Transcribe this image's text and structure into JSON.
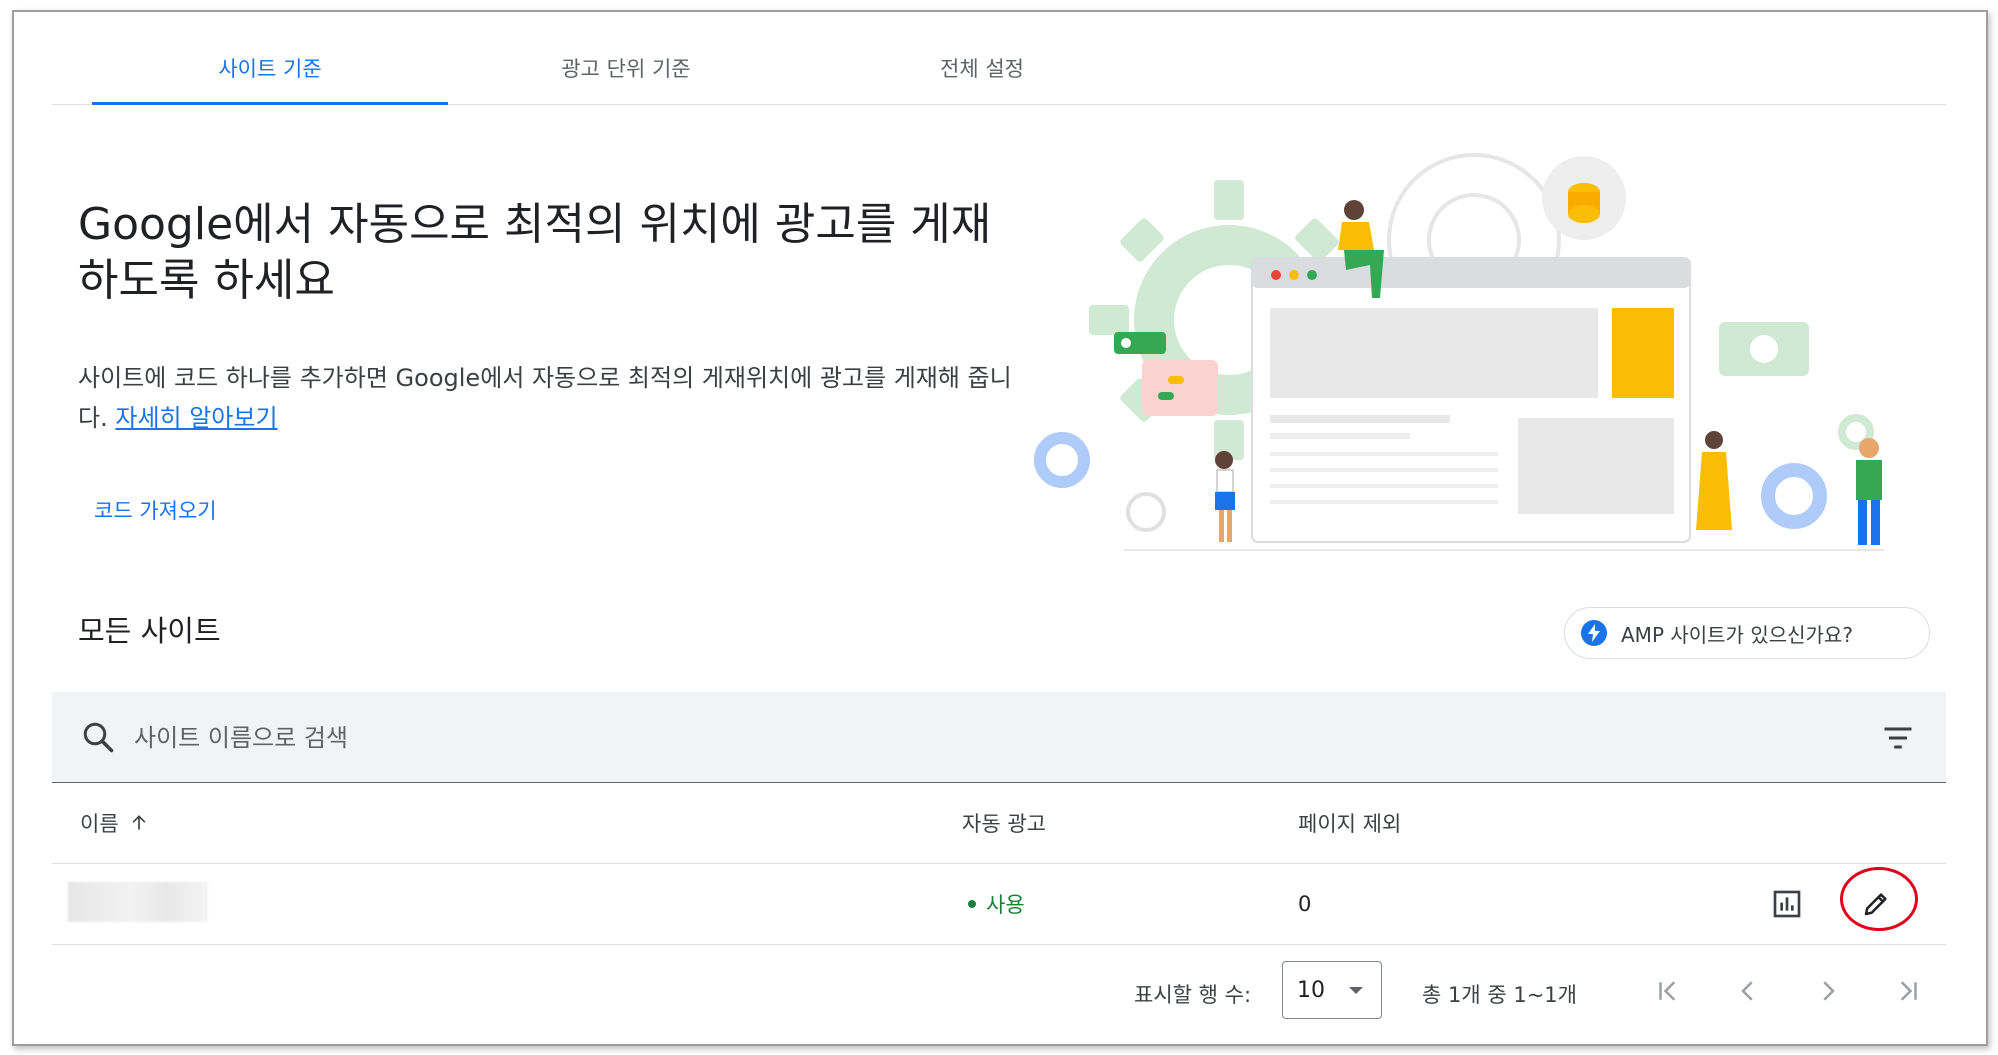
{
  "tabs": [
    {
      "label": "사이트 기준",
      "active": true
    },
    {
      "label": "광고 단위 기준",
      "active": false
    },
    {
      "label": "전체 설정",
      "active": false
    }
  ],
  "hero": {
    "title": "Google에서 자동으로 최적의 위치에 광고를 게재하도록 하세요",
    "description": "사이트에 코드 하나를 추가하면 Google에서 자동으로 최적의 게재위치에 광고를 게재해 줍니다.",
    "learn_more": "자세히 알아보기",
    "get_code": "코드 가져오기"
  },
  "sites": {
    "title": "모든 사이트",
    "amp_button": "AMP 사이트가 있으신가요?",
    "search_placeholder": "사이트 이름으로 검색",
    "columns": {
      "name": "이름",
      "auto_ads": "자동 광고",
      "excluded_pages": "페이지 제외"
    },
    "rows": [
      {
        "name": "",
        "status": "사용",
        "excluded": "0"
      }
    ]
  },
  "pagination": {
    "rows_label": "표시할 행 수:",
    "rows_value": "10",
    "range": "총 1개 중 1~1개"
  },
  "colors": {
    "accent": "#1a73e8",
    "status_on": "#188038",
    "highlight": "#e0001b"
  },
  "icons": [
    "sort-up-icon",
    "search-icon",
    "filter-icon",
    "report-icon",
    "edit-icon",
    "first-page-icon",
    "prev-page-icon",
    "next-page-icon",
    "last-page-icon",
    "amp-bolt-icon"
  ]
}
